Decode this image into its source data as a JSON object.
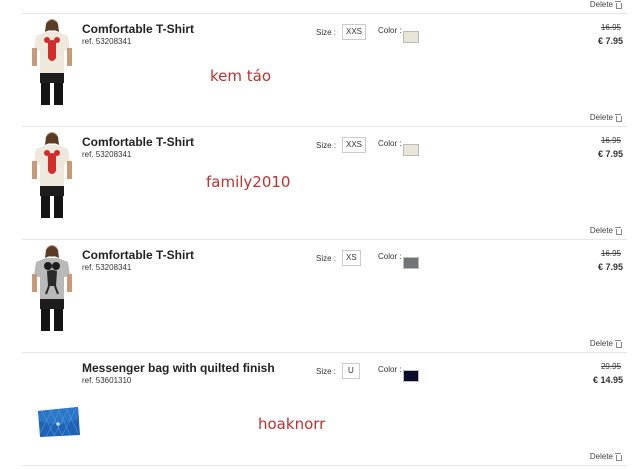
{
  "cart": {
    "top_delete_label": "Delete",
    "items": [
      {
        "name": "Comfortable T-Shirt",
        "ref": "ref. 53208341",
        "size_label": "Size :",
        "size": "XXS",
        "color_label": "Color :",
        "color_hex": "#e9e5d8",
        "price_old": "16.95",
        "price_new": "€ 7.95",
        "delete_label": "Delete",
        "watermark": "kem táo",
        "image": "tshirt-cream-red-print"
      },
      {
        "name": "Comfortable T-Shirt",
        "ref": "ref. 53208341",
        "size_label": "Size :",
        "size": "XXS",
        "color_label": "Color :",
        "color_hex": "#e9e5d8",
        "price_old": "16.95",
        "price_new": "€ 7.95",
        "delete_label": "Delete",
        "watermark": "family2010",
        "image": "tshirt-cream-red-print"
      },
      {
        "name": "Comfortable T-Shirt",
        "ref": "ref. 53208341",
        "size_label": "Size :",
        "size": "XS",
        "color_label": "Color :",
        "color_hex": "#717476",
        "price_old": "16.95",
        "price_new": "€ 7.95",
        "delete_label": "Delete",
        "watermark": "",
        "image": "tshirt-grey-mickey-print"
      },
      {
        "name": "Messenger bag with quilted finish",
        "ref": "ref. 53601310",
        "size_label": "Size :",
        "size": "U",
        "color_label": "Color :",
        "color_hex": "#0a0c2a",
        "price_old": "29.95",
        "price_new": "€ 14.95",
        "delete_label": "Delete",
        "watermark": "hoaknorr",
        "image": "blue-quilted-bag"
      }
    ]
  }
}
